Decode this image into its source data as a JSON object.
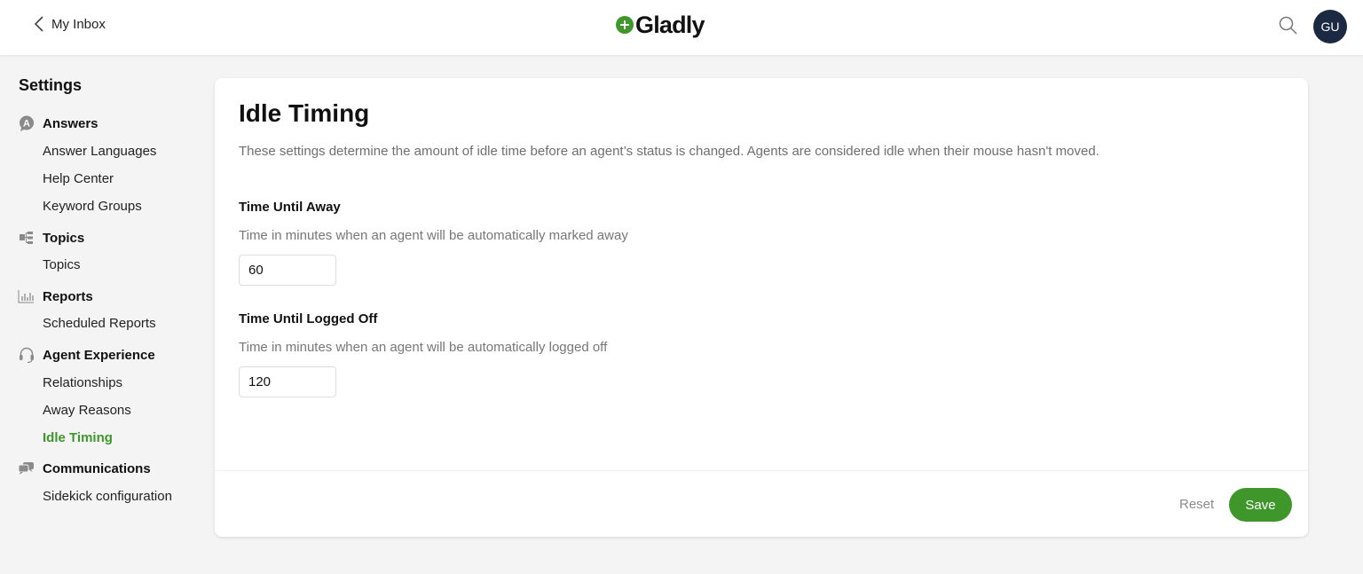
{
  "header": {
    "back_label": "My Inbox",
    "logo_text": "Gladly",
    "avatar_initials": "GU",
    "brand_color": "#3f962b"
  },
  "sidebar": {
    "title": "Settings",
    "sections": [
      {
        "label": "Answers",
        "icon": "answers-icon",
        "items": [
          "Answer Languages",
          "Help Center",
          "Keyword Groups"
        ]
      },
      {
        "label": "Topics",
        "icon": "topics-icon",
        "items": [
          "Topics"
        ]
      },
      {
        "label": "Reports",
        "icon": "reports-icon",
        "items": [
          "Scheduled Reports"
        ]
      },
      {
        "label": "Agent Experience",
        "icon": "headset-icon",
        "items": [
          "Relationships",
          "Away Reasons",
          "Idle Timing"
        ]
      },
      {
        "label": "Communications",
        "icon": "chat-bubbles-icon",
        "items": [
          "Sidekick configuration"
        ]
      }
    ],
    "active_item": "Idle Timing"
  },
  "main": {
    "title": "Idle Timing",
    "description": "These settings determine the amount of idle time before an agent’s status is changed. Agents are considered idle when their mouse hasn't moved.",
    "fields": [
      {
        "label": "Time Until Away",
        "help": "Time in minutes when an agent will be automatically marked away",
        "value": "60"
      },
      {
        "label": "Time Until Logged Off",
        "help": "Time in minutes when an agent will be automatically logged off",
        "value": "120"
      }
    ],
    "reset_label": "Reset",
    "save_label": "Save"
  }
}
